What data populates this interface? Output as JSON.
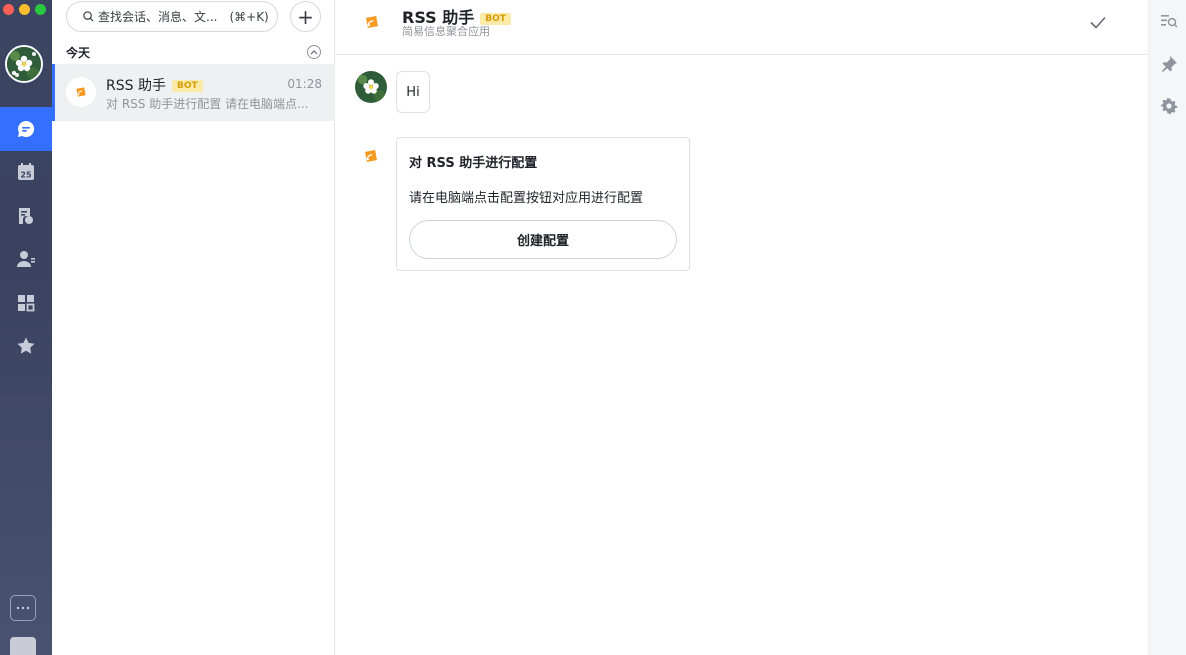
{
  "window": {
    "traffic_lights": [
      "close",
      "minimize",
      "zoom"
    ]
  },
  "nav": {
    "items": [
      {
        "name": "chat-icon",
        "active": true
      },
      {
        "name": "calendar-icon",
        "label": "25"
      },
      {
        "name": "docs-icon"
      },
      {
        "name": "contacts-icon"
      },
      {
        "name": "workplace-icon"
      },
      {
        "name": "favorites-icon"
      }
    ],
    "more_icon": "more-icon"
  },
  "sidebar": {
    "search_placeholder": "查找会话、消息、文...",
    "search_shortcut": "(⌘+K)",
    "add_label": "+",
    "section_title": "今天",
    "conversations": [
      {
        "name": "RSS 助手",
        "badge": "BOT",
        "time": "01:28",
        "preview": "对 RSS 助手进行配置 请在电脑端点..."
      }
    ]
  },
  "header": {
    "title": "RSS 助手",
    "badge": "BOT",
    "subtitle": "简易信息聚合应用"
  },
  "messages": {
    "user_text": "Hi",
    "card": {
      "title": "对 RSS 助手进行配置",
      "body": "请在电脑端点击配置按钮对应用进行配置",
      "button": "创建配置"
    }
  },
  "colors": {
    "accent": "#3370ff",
    "rail": "#3b4461",
    "bot_badge_bg": "#fbe9a6",
    "bot_badge_fg": "#d59b06",
    "rss_orange": "#f59a23"
  }
}
